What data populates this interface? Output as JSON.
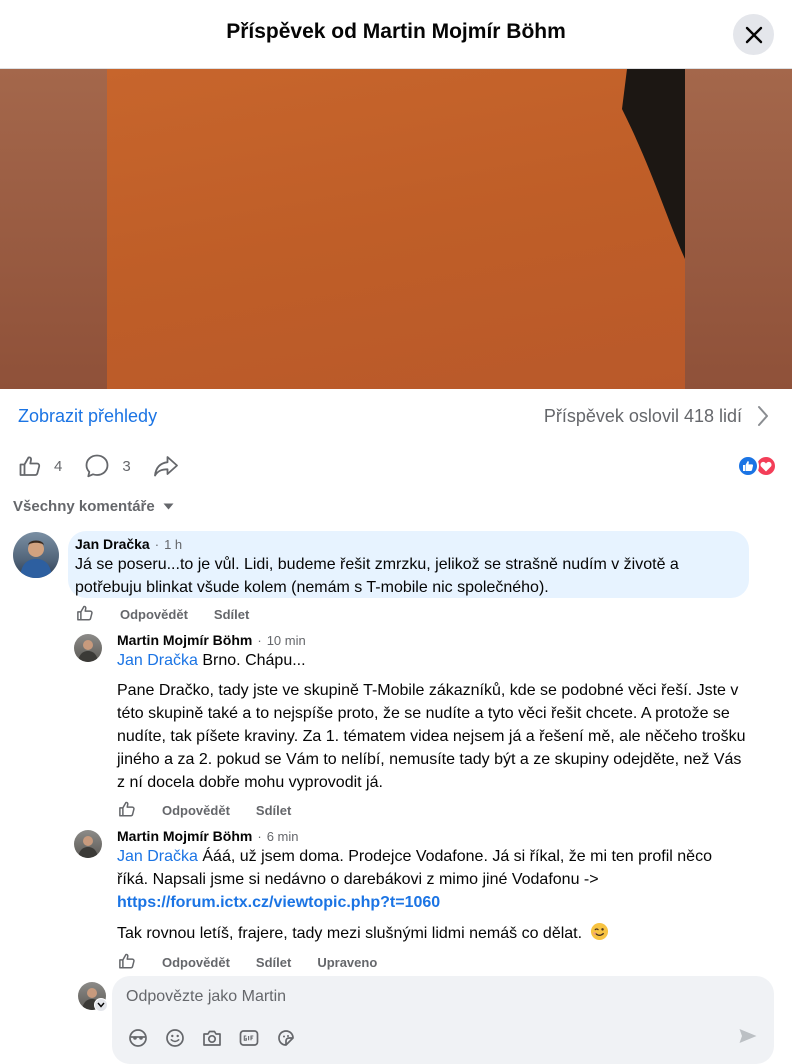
{
  "header": {
    "title": "Příspěvek od Martin Mojmír Böhm"
  },
  "post": {
    "insights_label": "Zobrazit přehledy",
    "reach_text": "Příspěvek oslovil 418 lidí",
    "likes_count": "4",
    "comments_count": "3"
  },
  "comments_sort": {
    "label": "Všechny komentáře"
  },
  "comments": [
    {
      "author": "Jan Dračka",
      "time": "1 h",
      "text": "Já se poseru...to je vůl. Lidi, budeme řešit zmrzku, jelikož se strašně nudím v životě a potřebuju blinkat všude kolem (nemám s T-mobile nic společného).",
      "like_label": "Odpovědět",
      "share_label": "Sdílet"
    },
    {
      "author": "Martin Mojmír Böhm",
      "time": "10 min",
      "mention": "Jan Dračka",
      "first_line": "Brno. Chápu...",
      "paragraph": "Pane Dračko, tady jste ve skupině T-Mobile zákazníků, kde se podobné věci řeší. Jste v této skupině také a to nejspíše proto, že se nudíte a tyto věci řešit chcete. A protože se nudíte, tak píšete kraviny. Za 1. tématem videa nejsem já a řešení mě, ale něčeho trošku jiného a za 2. pokud se Vám to nelíbí, nemusíte tady být a ze skupiny odejděte, než Vás z ní docela dobře mohu vyprovodit já.",
      "reply_label": "Odpovědět",
      "share_label": "Sdílet"
    },
    {
      "author": "Martin Mojmír Böhm",
      "time": "6 min",
      "mention": "Jan Dračka",
      "text_before_link": "Ááá, už jsem doma. Prodejce Vodafone. Já si říkal, že mi ten profil něco říká. Napsali jsme si nedávno o darebákovi z mimo jiné Vodafonu ->",
      "link_text": "https://forum.ictx.cz/viewtopic.php?t=1060",
      "paragraph": "Tak rovnou letíš, frajere, tady mezi slušnými lidmi nemáš co dělat.",
      "reply_label": "Odpovědět",
      "share_label": "Sdílet",
      "edited_label": "Upraveno"
    }
  ],
  "reply_box": {
    "placeholder": "Odpovězte jako Martin"
  },
  "icons": [
    "close-icon",
    "chevron-right-icon",
    "like-icon",
    "comment-icon",
    "share-icon",
    "like-reaction-icon",
    "love-reaction-icon",
    "caret-down-icon",
    "avatar-icon",
    "emoji-face-icon",
    "camera-icon",
    "gif-icon",
    "sticker-icon",
    "send-icon",
    "wink-emoji-icon"
  ],
  "colors": {
    "accent": "#1b74e4",
    "secondary_text": "#65676b",
    "highlight_bubble": "#e7f3ff",
    "bubble": "#f0f2f5"
  }
}
